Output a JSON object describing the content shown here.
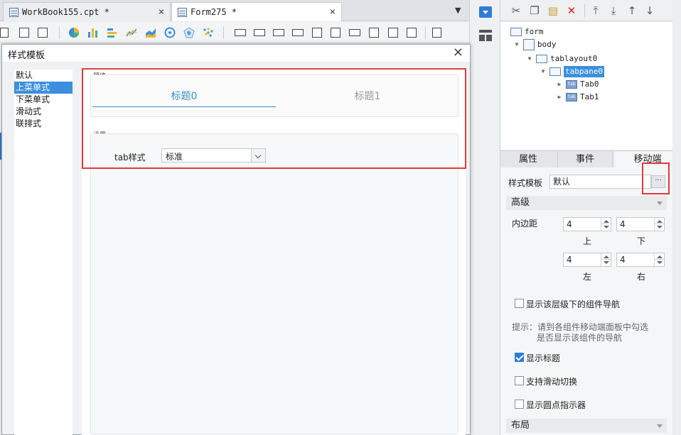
{
  "tabs": [
    {
      "label": "WorkBook155.cpt *",
      "active": false
    },
    {
      "label": "Form275 *",
      "active": true
    }
  ],
  "dialog": {
    "title": "样式模板",
    "style_list": [
      "默认",
      "上菜单式",
      "下菜单式",
      "滑动式",
      "联排式"
    ],
    "selected_index": 1,
    "preview_label": "预览",
    "preview_tabs": [
      "标题0",
      "标题1"
    ],
    "settings_label": "设置",
    "tab_style_label": "tab样式",
    "tab_style_value": "标准"
  },
  "tree": {
    "nodes": [
      "form",
      "body",
      "tablayout0",
      "tabpane0",
      "Tab0",
      "Tab1"
    ],
    "selected": "tabpane0",
    "tab_icon_text": "tab"
  },
  "properties": {
    "tabs": [
      "属性",
      "事件",
      "移动端"
    ],
    "active_tab": "移动端",
    "style_template_label": "样式模板",
    "style_template_value": "默认",
    "more_button": "···",
    "advanced_section": "高级",
    "padding_label": "内边距",
    "padding": {
      "top": "4",
      "bottom": "4",
      "left": "4",
      "right": "4"
    },
    "padding_captions": {
      "top": "上",
      "bottom": "下",
      "left": "左",
      "right": "右"
    },
    "show_nav_label": "显示该层级下的组件导航",
    "show_nav_checked": false,
    "hint_line1": "提示：请到各组件移动端面板中勾选",
    "hint_line2": "是否显示该组件的导航",
    "show_title_label": "显示标题",
    "show_title_checked": true,
    "swipe_label": "支持滑动切换",
    "swipe_checked": false,
    "dot_indicator_label": "显示圆点指示器",
    "dot_indicator_checked": false,
    "layout_section": "布局"
  },
  "colors": {
    "accent": "#3b8fdd",
    "highlight": "#e03c3c",
    "tab_active_text": "#3b8fc5"
  }
}
